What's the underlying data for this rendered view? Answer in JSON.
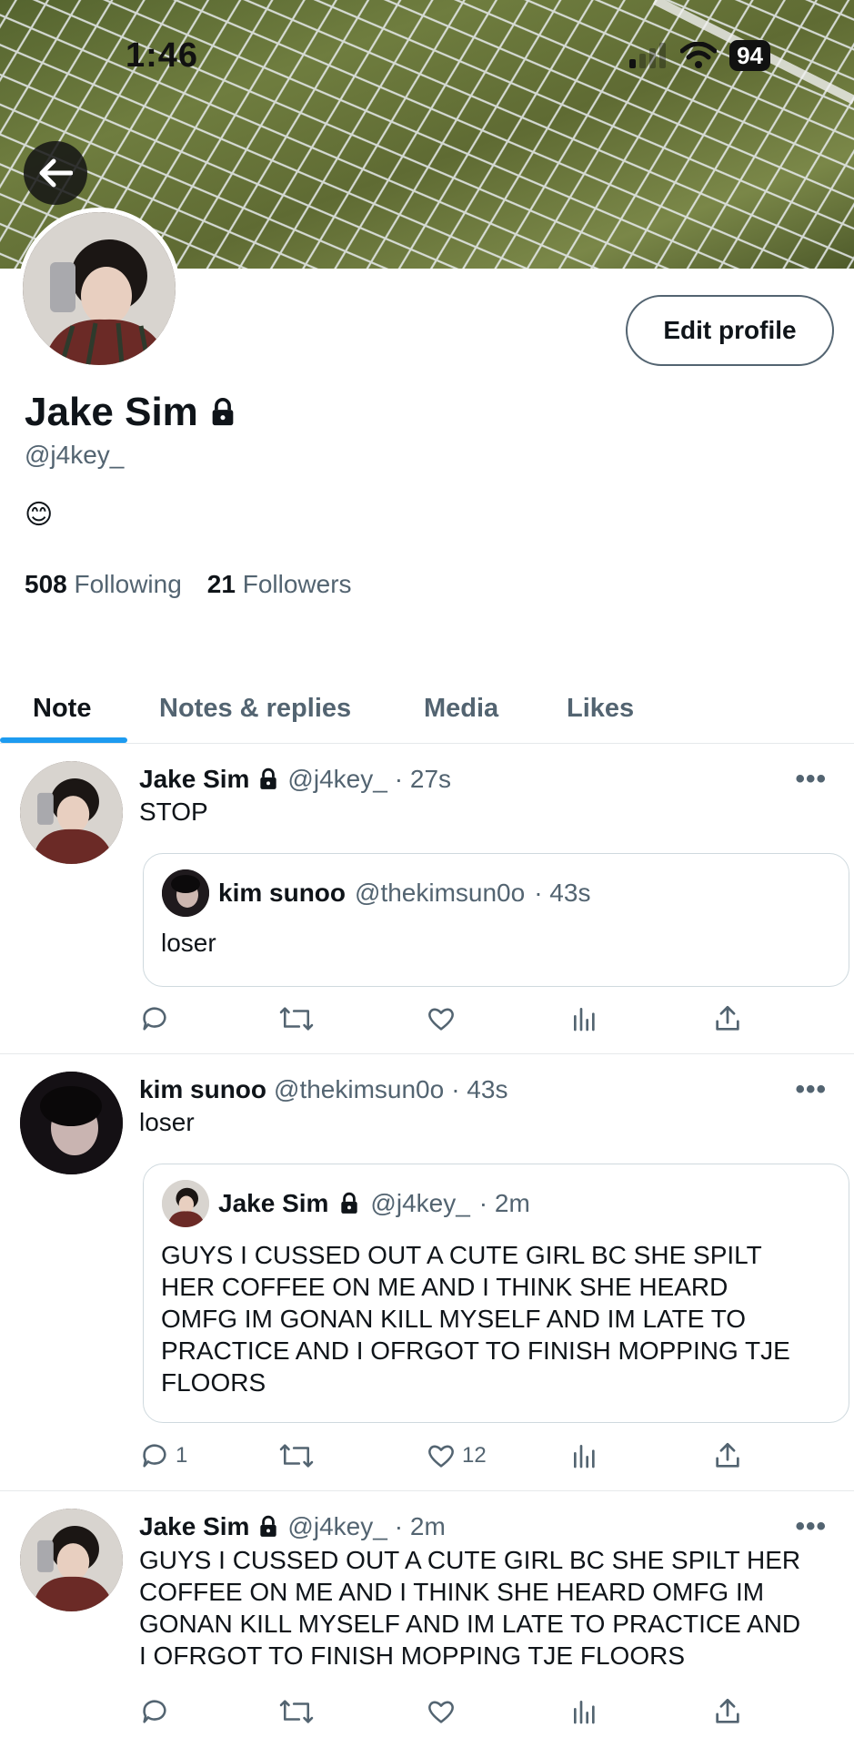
{
  "status_bar": {
    "time": "1:46",
    "battery": "94"
  },
  "profile": {
    "display_name": "Jake Sim",
    "handle": "@j4key_",
    "bio": "😊",
    "following_count": "508",
    "following_label": "Following",
    "followers_count": "21",
    "followers_label": "Followers",
    "edit_label": "Edit profile"
  },
  "tabs": [
    {
      "label": "Note",
      "active": true
    },
    {
      "label": "Notes & replies",
      "active": false
    },
    {
      "label": "Media",
      "active": false
    },
    {
      "label": "Likes",
      "active": false
    }
  ],
  "posts": [
    {
      "author": "Jake Sim",
      "handle": "@j4key_",
      "time": "· 27s",
      "locked": true,
      "text": "STOP",
      "quote": {
        "author": "kim sunoo",
        "handle": "@thekimsun0o",
        "time": "· 43s",
        "locked": false,
        "text": "loser"
      },
      "replies": "",
      "likes": ""
    },
    {
      "author": "kim sunoo",
      "handle": "@thekimsun0o",
      "time": "· 43s",
      "locked": false,
      "text": "loser",
      "quote": {
        "author": "Jake Sim",
        "handle": "@j4key_",
        "time": "· 2m",
        "locked": true,
        "text_lines": [
          "GUYS I CUSSED OUT A CUTE GIRL BC SHE SPILT",
          "HER COFFEE ON ME AND I THINK SHE HEARD",
          "OMFG IM GONAN KILL MYSELF AND IM LATE TO",
          "PRACTICE AND I OFRGOT TO FINISH MOPPING TJE",
          "FLOORS"
        ]
      },
      "replies": "1",
      "likes": "12"
    },
    {
      "author": "Jake Sim",
      "handle": "@j4key_",
      "time": "· 2m",
      "locked": true,
      "text_lines": [
        "GUYS I CUSSED OUT A CUTE GIRL BC SHE SPILT HER",
        "COFFEE ON ME AND I THINK SHE HEARD OMFG IM",
        "GONAN KILL MYSELF AND IM LATE TO PRACTICE AND",
        "I OFRGOT TO FINISH MOPPING TJE FLOORS"
      ],
      "replies": "",
      "likes": ""
    }
  ],
  "icons": {
    "lock": "lock-icon",
    "reply": "reply-icon",
    "repost": "repost-icon",
    "like": "heart-icon",
    "views": "views-icon",
    "share": "share-icon",
    "more": "more-icon",
    "back": "back-arrow-icon"
  },
  "colors": {
    "accent": "#1d9bf0",
    "secondary_text": "#536471",
    "primary_text": "#0f1419"
  }
}
